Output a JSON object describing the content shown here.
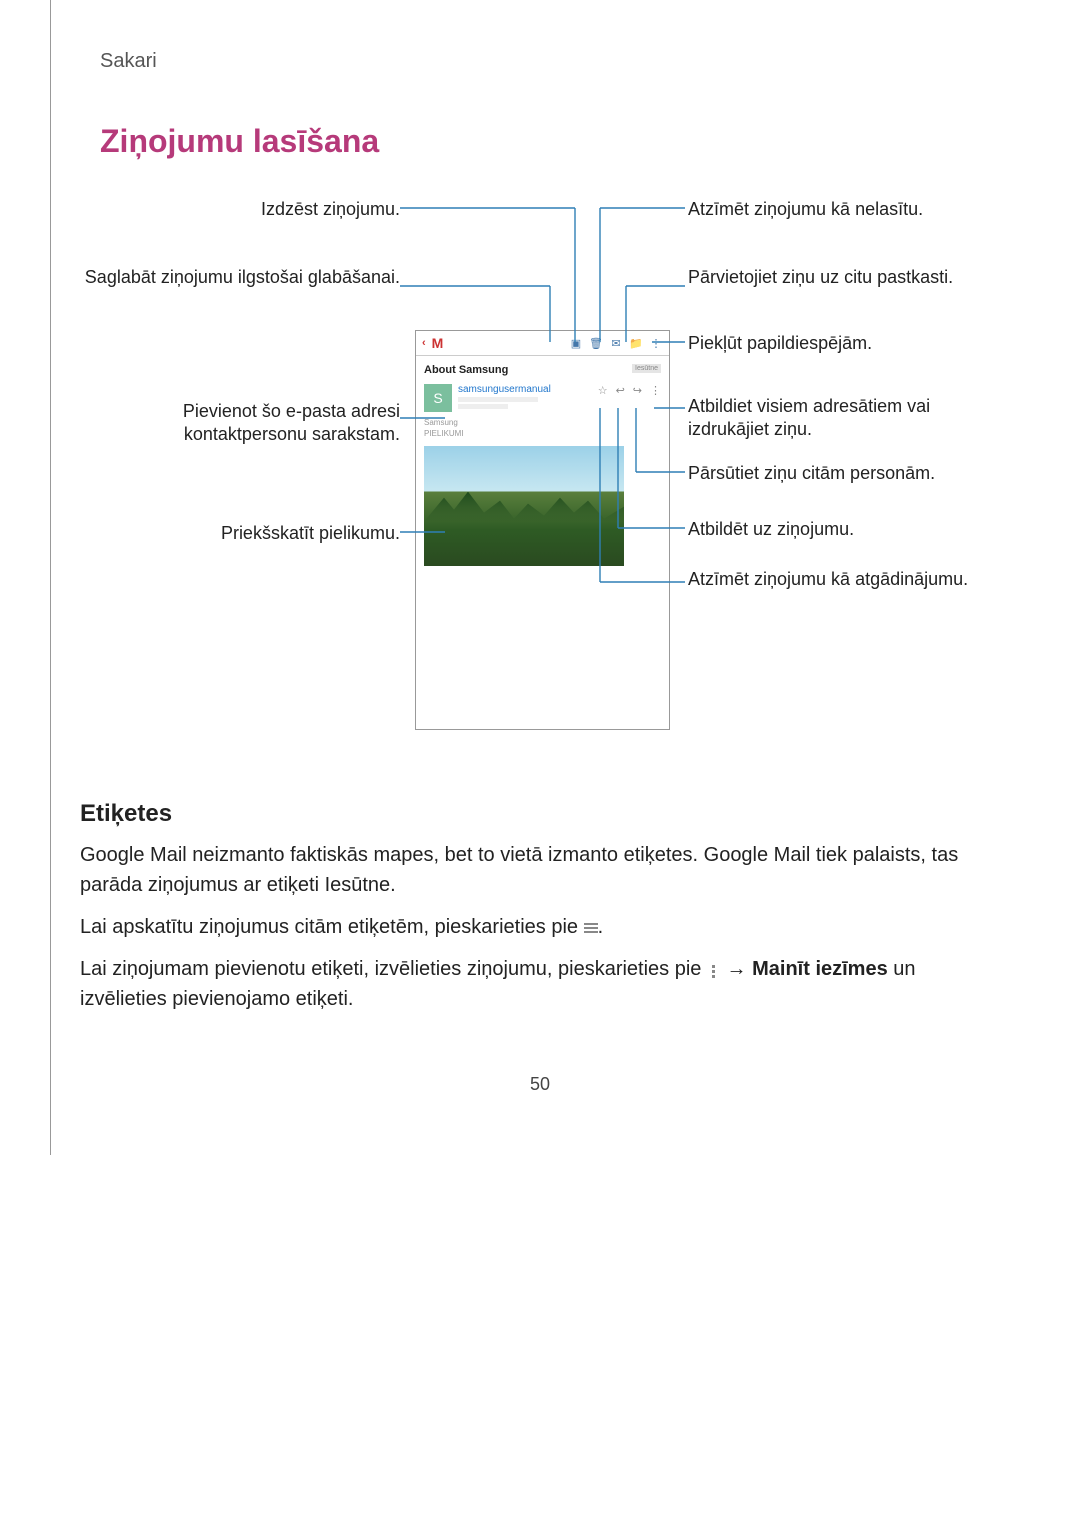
{
  "header": {
    "section": "Sakari"
  },
  "title": "Ziņojumu lasīšana",
  "callouts": {
    "left1": "Izdzēst ziņojumu.",
    "left2": "Saglabāt ziņojumu ilgstošai glabāšanai.",
    "left3": "Pievienot šo e-pasta adresi kontaktpersonu sarakstam.",
    "left4": "Priekšskatīt pielikumu.",
    "right1": "Atzīmēt ziņojumu kā nelasītu.",
    "right2": "Pārvietojiet ziņu uz citu pastkasti.",
    "right3": "Piekļūt papildiespējām.",
    "right4": "Atbildiet visiem adresātiem vai izdrukājiet ziņu.",
    "right5": "Pārsūtiet ziņu citām personām.",
    "right6": "Atbildēt uz ziņojumu.",
    "right7": "Atzīmēt ziņojumu kā atgādinājumu."
  },
  "device": {
    "subject": "About Samsung",
    "badge": "Iesūtne",
    "sender": "samsungusermanual",
    "body_brand": "Samsung",
    "attach_label": "PIELIKUMI"
  },
  "etiketes": {
    "heading": "Etiķetes",
    "p1": "Google Mail neizmanto faktiskās mapes, bet to vietā izmanto etiķetes. Google Mail tiek palaists, tas parāda ziņojumus ar etiķeti Iesūtne.",
    "p2a": "Lai apskatītu ziņojumus citām etiķetēm, pieskarieties pie ",
    "p2b": ".",
    "p3a": "Lai ziņojumam pievienotu etiķeti, izvēlieties ziņojumu, pieskarieties pie ",
    "p3b": " → ",
    "p3c": "Mainīt iezīmes",
    "p3d": " un izvēlieties pievienojamo etiķeti."
  },
  "page_number": "50"
}
